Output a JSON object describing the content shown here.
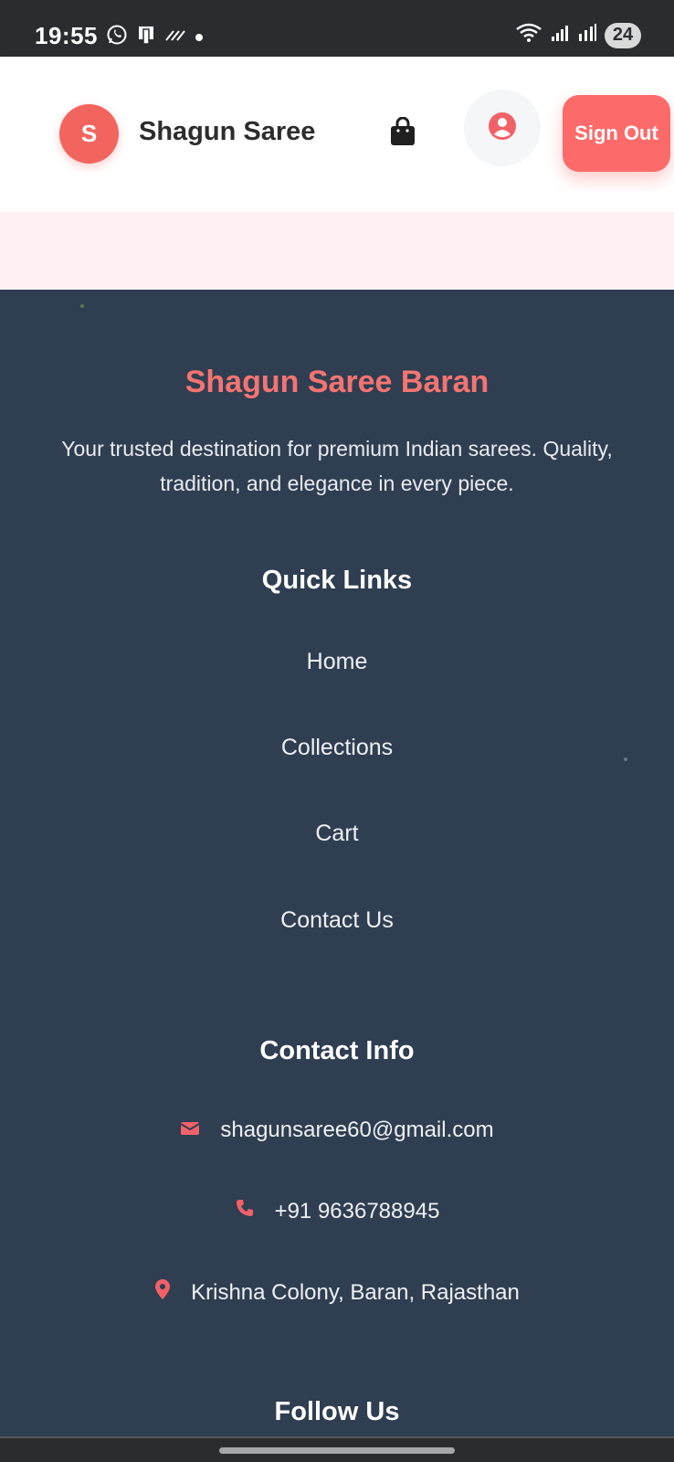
{
  "status_bar": {
    "time": "19:55",
    "battery": "24",
    "icons": [
      "whatsapp-icon",
      "sim-icon",
      "signal-strength-icon",
      "notification-dot",
      "wifi-icon",
      "cell-signal-icon",
      "roaming-signal-icon"
    ]
  },
  "header": {
    "avatar_letter": "S",
    "brand_name": "Shagun Saree",
    "cart_icon": "shopping-bag-icon",
    "profile_icon": "user-circle-icon",
    "sign_out_label": "Sign Out"
  },
  "footer": {
    "brand": "Shagun Saree Baran",
    "tagline": "Your trusted destination for premium Indian sarees. Quality, tradition, and elegance in every piece.",
    "quick_links": {
      "title": "Quick Links",
      "links": [
        "Home",
        "Collections",
        "Cart",
        "Contact Us"
      ]
    },
    "contact_info": {
      "title": "Contact Info",
      "email": "shagunsaree60@gmail.com",
      "phone": "+91 9636788945",
      "address": "Krishna Colony, Baran, Rajasthan"
    },
    "follow_us": {
      "title": "Follow Us"
    }
  },
  "colors": {
    "accent": "#fd6a6a",
    "footer_bg": "#2f3e51",
    "brand_text": "#f47472",
    "pink_band": "#fff0f3"
  }
}
